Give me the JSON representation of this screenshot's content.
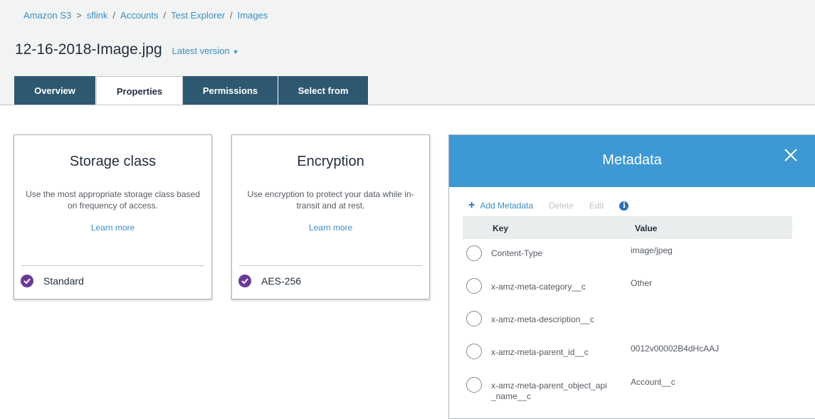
{
  "breadcrumb": {
    "items": [
      "Amazon S3",
      "sflink",
      "Accounts",
      "Test Explorer",
      "Images"
    ],
    "separators": [
      ">",
      "/",
      "/",
      "/"
    ]
  },
  "object": {
    "title": "12-16-2018-Image.jpg",
    "version_label": "Latest version"
  },
  "tabs": [
    {
      "label": "Overview",
      "active": false
    },
    {
      "label": "Properties",
      "active": true
    },
    {
      "label": "Permissions",
      "active": false
    },
    {
      "label": "Select from",
      "active": false
    }
  ],
  "cards": {
    "storage": {
      "title": "Storage class",
      "description": "Use the most appropriate storage class based on frequency of access.",
      "link": "Learn more",
      "selected": "Standard"
    },
    "encryption": {
      "title": "Encryption",
      "description": "Use encryption to protect your data while in-transit and at rest.",
      "link": "Learn more",
      "selected": "AES-256"
    }
  },
  "metadata": {
    "title": "Metadata",
    "actions": {
      "add": "Add Metadata",
      "delete": "Delete",
      "edit": "Edit"
    },
    "columns": {
      "key": "Key",
      "value": "Value"
    },
    "rows": [
      {
        "key": "Content-Type",
        "value": "image/jpeg"
      },
      {
        "key": "x-amz-meta-category__c",
        "value": "Other"
      },
      {
        "key": "x-amz-meta-description__c",
        "value": ""
      },
      {
        "key": "x-amz-meta-parent_id__c",
        "value": "0012v00002B4dHcAAJ"
      },
      {
        "key": "x-amz-meta-parent_object_api_name__c",
        "value": "Account__c"
      }
    ]
  },
  "colors": {
    "accent": "#3d98d3",
    "tab_dark": "#2e5870",
    "check_purple": "#6b3a96",
    "link_blue": "#3b8fc4"
  },
  "icons": [
    "check-circle-icon",
    "close-icon",
    "plus-icon",
    "info-icon",
    "chevron-down-icon"
  ]
}
